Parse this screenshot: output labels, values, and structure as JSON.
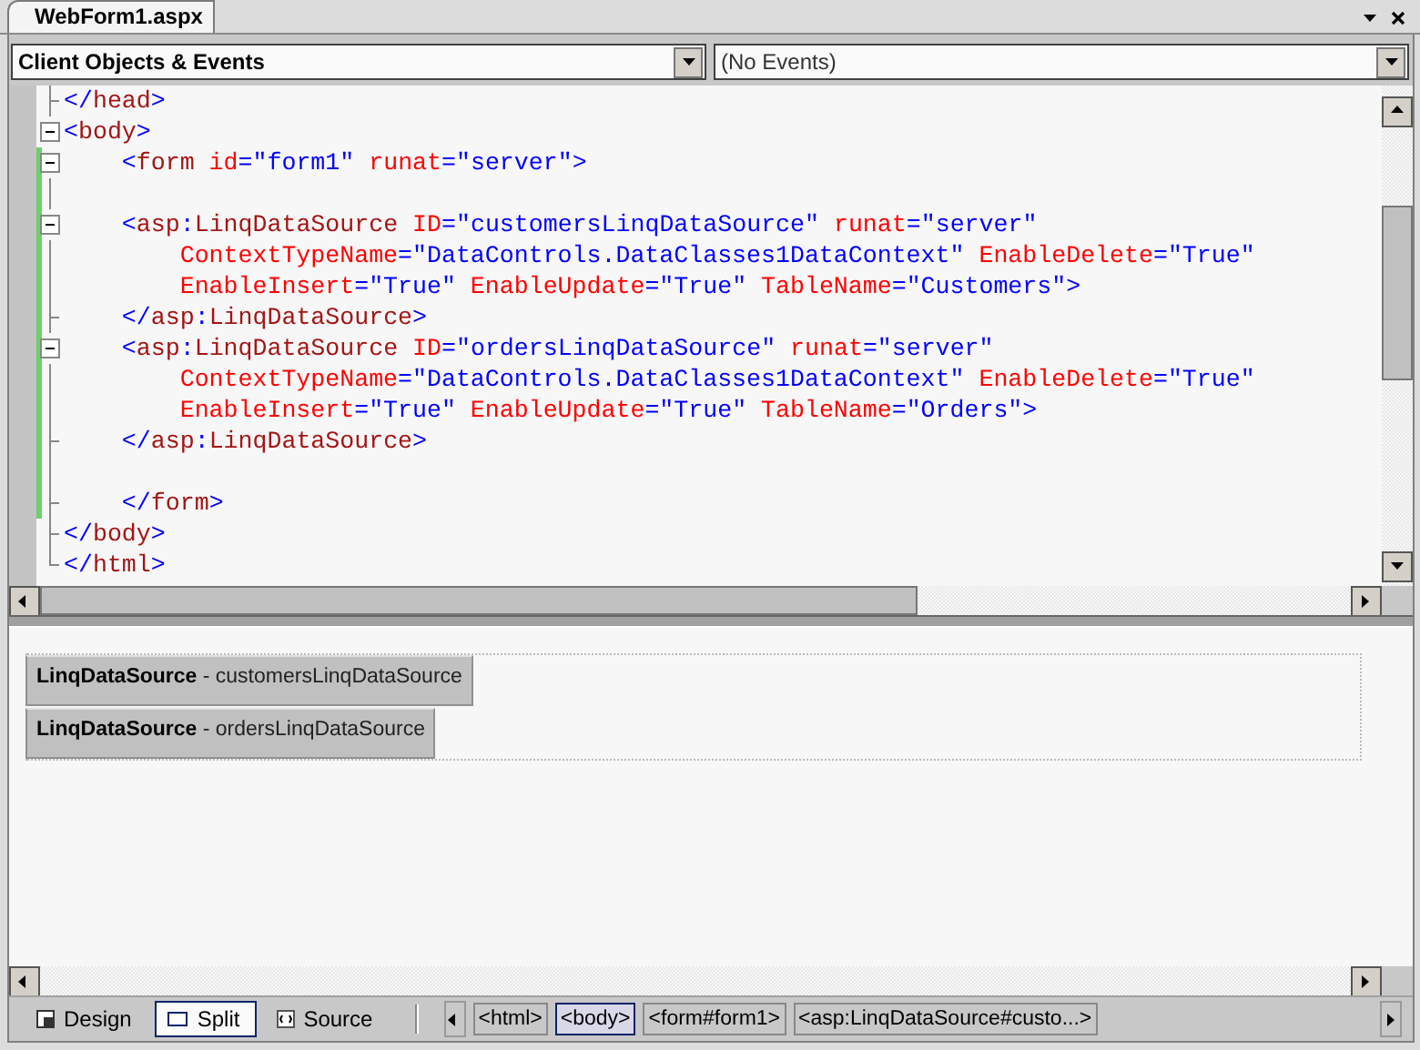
{
  "document_tab": {
    "title": "WebForm1.aspx",
    "selected": true
  },
  "object_dropdown": {
    "value": "Client Objects & Events"
  },
  "event_dropdown": {
    "value": "(No Events)"
  },
  "source_lines": [
    {
      "kind": "tick",
      "changed": false,
      "tokens": [
        {
          "kind": "delim",
          "text": "</"
        },
        {
          "kind": "tag",
          "text": "head"
        },
        {
          "kind": "delim",
          "text": ">"
        }
      ]
    },
    {
      "kind": "collapsible",
      "changed": false,
      "tokens": [
        {
          "kind": "delim",
          "text": "<"
        },
        {
          "kind": "tag",
          "text": "body"
        },
        {
          "kind": "delim",
          "text": ">"
        }
      ]
    },
    {
      "kind": "collapsible",
      "changed": true,
      "tokens": [
        {
          "kind": "delim",
          "text": "    <"
        },
        {
          "kind": "tag",
          "text": "form"
        },
        {
          "kind": "attr",
          "text": " id"
        },
        {
          "kind": "value",
          "text": "=\"form1\""
        },
        {
          "kind": "attr",
          "text": " runat"
        },
        {
          "kind": "value",
          "text": "=\"server\">"
        }
      ]
    },
    {
      "kind": "continued",
      "changed": true
    },
    {
      "kind": "collapsible",
      "changed": true,
      "tokens": [
        {
          "kind": "delim",
          "text": "    <"
        },
        {
          "kind": "tag",
          "text": "asp"
        },
        {
          "kind": "delim",
          "text": ":"
        },
        {
          "kind": "tag",
          "text": "LinqDataSource"
        },
        {
          "kind": "attr",
          "text": " ID"
        },
        {
          "kind": "value",
          "text": "=\"customersLinqDataSource\""
        },
        {
          "kind": "attr",
          "text": " runat"
        },
        {
          "kind": "value",
          "text": "=\"server\""
        }
      ]
    },
    {
      "kind": "continued",
      "changed": true,
      "tokens": [
        {
          "kind": "attr",
          "text": "        ContextTypeName"
        },
        {
          "kind": "value",
          "text": "=\"DataControls.DataClasses1DataContext\""
        },
        {
          "kind": "attr",
          "text": " EnableDelete"
        },
        {
          "kind": "value",
          "text": "=\"True\""
        }
      ]
    },
    {
      "kind": "continued",
      "changed": true,
      "tokens": [
        {
          "kind": "attr",
          "text": "        EnableInsert"
        },
        {
          "kind": "value",
          "text": "=\"True\""
        },
        {
          "kind": "attr",
          "text": " EnableUpdate"
        },
        {
          "kind": "value",
          "text": "=\"True\""
        },
        {
          "kind": "attr",
          "text": " TableName"
        },
        {
          "kind": "value",
          "text": "=\"Customers\">"
        }
      ]
    },
    {
      "kind": "tick",
      "changed": true,
      "tokens": [
        {
          "kind": "delim",
          "text": "    </"
        },
        {
          "kind": "tag",
          "text": "asp"
        },
        {
          "kind": "delim",
          "text": ":"
        },
        {
          "kind": "tag",
          "text": "LinqDataSource"
        },
        {
          "kind": "delim",
          "text": ">"
        }
      ]
    },
    {
      "kind": "collapsible",
      "changed": true,
      "tokens": [
        {
          "kind": "delim",
          "text": "    <"
        },
        {
          "kind": "tag",
          "text": "asp"
        },
        {
          "kind": "delim",
          "text": ":"
        },
        {
          "kind": "tag",
          "text": "LinqDataSource"
        },
        {
          "kind": "attr",
          "text": " ID"
        },
        {
          "kind": "value",
          "text": "=\"ordersLinqDataSource\""
        },
        {
          "kind": "attr",
          "text": " runat"
        },
        {
          "kind": "value",
          "text": "=\"server\""
        }
      ]
    },
    {
      "kind": "continued",
      "changed": true,
      "tokens": [
        {
          "kind": "attr",
          "text": "        ContextTypeName"
        },
        {
          "kind": "value",
          "text": "=\"DataControls.DataClasses1DataContext\""
        },
        {
          "kind": "attr",
          "text": " EnableDelete"
        },
        {
          "kind": "value",
          "text": "=\"True\""
        }
      ]
    },
    {
      "kind": "continued",
      "changed": true,
      "tokens": [
        {
          "kind": "attr",
          "text": "        EnableInsert"
        },
        {
          "kind": "value",
          "text": "=\"True\""
        },
        {
          "kind": "attr",
          "text": " EnableUpdate"
        },
        {
          "kind": "value",
          "text": "=\"True\""
        },
        {
          "kind": "attr",
          "text": " TableName"
        },
        {
          "kind": "value",
          "text": "=\"Orders\">"
        }
      ]
    },
    {
      "kind": "tick",
      "changed": true,
      "tokens": [
        {
          "kind": "delim",
          "text": "    </"
        },
        {
          "kind": "tag",
          "text": "asp"
        },
        {
          "kind": "delim",
          "text": ":"
        },
        {
          "kind": "tag",
          "text": "LinqDataSource"
        },
        {
          "kind": "delim",
          "text": ">"
        }
      ]
    },
    {
      "kind": "continued",
      "changed": true
    },
    {
      "kind": "tick",
      "changed": true,
      "tokens": [
        {
          "kind": "delim",
          "text": "    </"
        },
        {
          "kind": "tag",
          "text": "form"
        },
        {
          "kind": "delim",
          "text": ">"
        }
      ]
    },
    {
      "kind": "tick",
      "changed": false,
      "tokens": [
        {
          "kind": "delim",
          "text": "</"
        },
        {
          "kind": "tag",
          "text": "body"
        },
        {
          "kind": "delim",
          "text": ">"
        }
      ]
    },
    {
      "kind": "last",
      "changed": false,
      "tokens": [
        {
          "kind": "delim",
          "text": "</"
        },
        {
          "kind": "tag",
          "text": "html"
        },
        {
          "kind": "delim",
          "text": ">"
        }
      ]
    }
  ],
  "design_controls": [
    {
      "label": "**LinqDataSource** - customersLinqDataSource"
    },
    {
      "label": "**LinqDataSource** - ordersLinqDataSource"
    }
  ],
  "view_tabs": [
    {
      "label": "Design",
      "selected": false
    },
    {
      "label": "Split",
      "selected": true
    },
    {
      "label": "Source",
      "selected": false
    }
  ],
  "breadcrumbs": [
    {
      "label": "<html>",
      "selected": false
    },
    {
      "label": "<body>",
      "selected": true
    },
    {
      "label": "<form#form1>",
      "selected": false
    },
    {
      "label": "<asp:LinqDataSource#custo...>",
      "selected": false
    }
  ]
}
